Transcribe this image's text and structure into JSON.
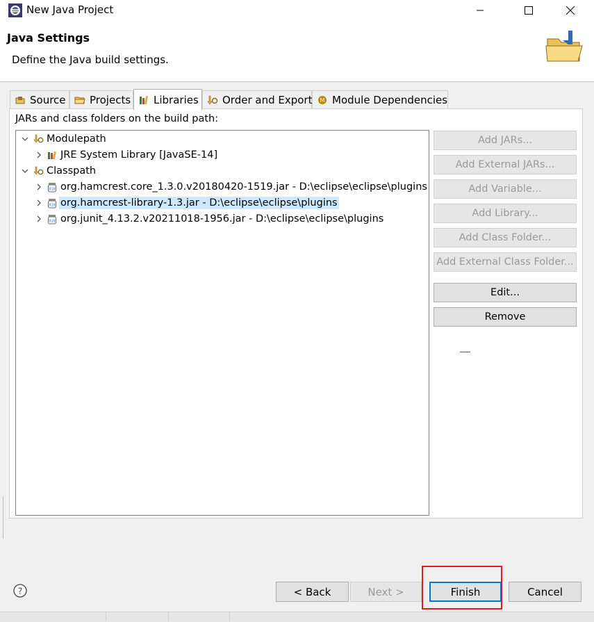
{
  "window": {
    "title": "New Java Project",
    "controls": [
      "minimize",
      "maximize",
      "close"
    ]
  },
  "header": {
    "title": "Java Settings",
    "description": "Define the Java build settings.",
    "icon": "folder-icon"
  },
  "tabs": [
    {
      "label": "Source",
      "icon": "source-icon",
      "active": false
    },
    {
      "label": "Projects",
      "icon": "projects-icon",
      "active": false
    },
    {
      "label": "Libraries",
      "icon": "libraries-icon",
      "active": true
    },
    {
      "label": "Order and Export",
      "icon": "order-export-icon",
      "active": false
    },
    {
      "label": "Module Dependencies",
      "icon": "module-icon",
      "active": false
    }
  ],
  "panel": {
    "label": "JARs and class folders on the build path:"
  },
  "tree": {
    "modulepath": {
      "label": "Modulepath",
      "items": [
        {
          "label": "JRE System Library [JavaSE-14]",
          "icon": "library-icon"
        }
      ]
    },
    "classpath": {
      "label": "Classpath",
      "items": [
        {
          "label": "org.hamcrest.core_1.3.0.v20180420-1519.jar - D:\\eclipse\\eclipse\\plugins",
          "icon": "jar-icon",
          "selected": false
        },
        {
          "label": "org.hamcrest-library-1.3.jar - D:\\eclipse\\eclipse\\plugins",
          "icon": "jar-icon",
          "selected": true
        },
        {
          "label": "org.junit_4.13.2.v20211018-1956.jar - D:\\eclipse\\eclipse\\plugins",
          "icon": "jar-icon",
          "selected": false
        }
      ]
    }
  },
  "side_buttons": {
    "add_jars": "Add JARs...",
    "add_external_jars": "Add External JARs...",
    "add_variable": "Add Variable...",
    "add_library": "Add Library...",
    "add_class_folder": "Add Class Folder...",
    "add_external_class_folder": "Add External Class Folder...",
    "edit": "Edit...",
    "remove": "Remove"
  },
  "footer": {
    "back": "< Back",
    "next": "Next >",
    "finish": "Finish",
    "cancel": "Cancel"
  },
  "colors": {
    "selection": "#cce8ff",
    "highlight_box": "#e01c1c",
    "default_button_border": "#0078d7"
  }
}
